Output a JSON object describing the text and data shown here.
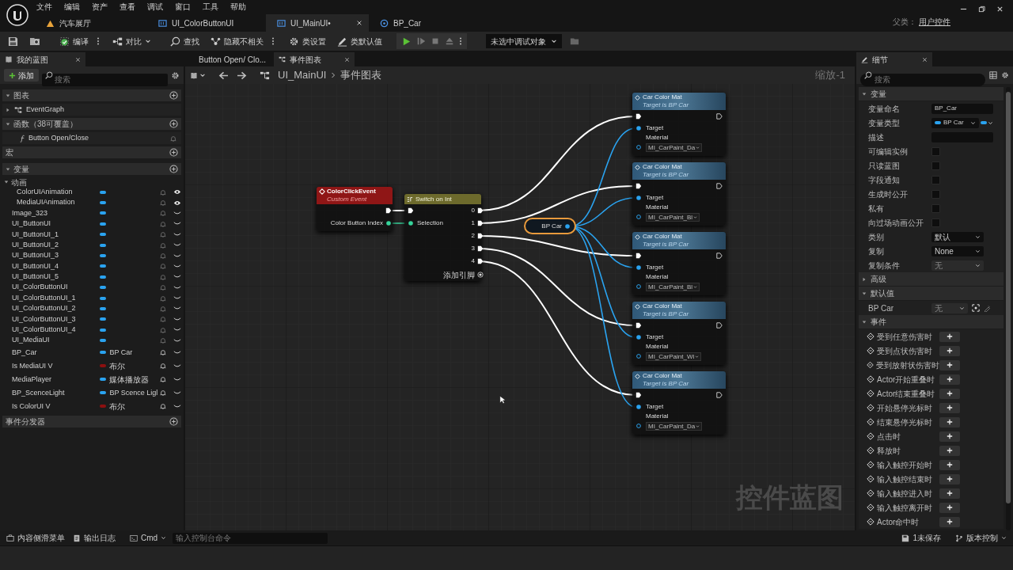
{
  "menu": [
    "文件",
    "编辑",
    "资产",
    "查看",
    "调试",
    "窗口",
    "工具",
    "帮助"
  ],
  "doc_tabs": [
    {
      "label": "汽车展厅",
      "selected": false
    },
    {
      "label": "UI_ColorButtonUI",
      "selected": false
    },
    {
      "label": "UI_MainUI•",
      "selected": true
    },
    {
      "label": "BP_Car",
      "selected": false
    }
  ],
  "parent_class": {
    "label": "父类：",
    "value": "用户控件"
  },
  "toolbar": {
    "compile": "编译",
    "diff": "对比",
    "find": "查找",
    "hide": "隐藏不相关",
    "class_settings": "类设置",
    "class_defaults": "类默认值",
    "debug_target": "未选中调试对象"
  },
  "my_blueprint": {
    "title": "我的蓝图",
    "add": "添加",
    "search_placeholder": "搜索",
    "items": [
      {
        "kind": "header",
        "label": "图表",
        "expanded": true
      },
      {
        "kind": "graph",
        "label": "EventGraph"
      },
      {
        "kind": "header",
        "label": "函数（38可覆盖）",
        "expanded": true
      },
      {
        "kind": "function",
        "label": "Button Open/Close"
      },
      {
        "kind": "plain_header",
        "label": "宏"
      },
      {
        "kind": "header",
        "label": "变量",
        "expanded": true
      },
      {
        "kind": "category",
        "label": "动画"
      },
      {
        "kind": "anim_var",
        "name": "ColorUIAnimation",
        "color": "#2aa3f0"
      },
      {
        "kind": "anim_var",
        "name": "MediaUIAnimation",
        "color": "#2aa3f0"
      },
      {
        "kind": "var",
        "name": "Image_323",
        "color": "#2aa3f0"
      },
      {
        "kind": "var",
        "name": "UI_ButtonUI",
        "color": "#2aa3f0"
      },
      {
        "kind": "var",
        "name": "UI_ButtonUI_1",
        "color": "#2aa3f0"
      },
      {
        "kind": "var",
        "name": "UI_ButtonUI_2",
        "color": "#2aa3f0"
      },
      {
        "kind": "var",
        "name": "UI_ButtonUI_3",
        "color": "#2aa3f0"
      },
      {
        "kind": "var",
        "name": "UI_ButtonUI_4",
        "color": "#2aa3f0"
      },
      {
        "kind": "var",
        "name": "UI_ButtonUI_5",
        "color": "#2aa3f0"
      },
      {
        "kind": "var",
        "name": "UI_ColorButtonUI",
        "color": "#2aa3f0"
      },
      {
        "kind": "var",
        "name": "UI_ColorButtonUI_1",
        "color": "#2aa3f0"
      },
      {
        "kind": "var",
        "name": "UI_ColorButtonUI_2",
        "color": "#2aa3f0"
      },
      {
        "kind": "var",
        "name": "UI_ColorButtonUI_3",
        "color": "#2aa3f0"
      },
      {
        "kind": "var",
        "name": "UI_ColorButtonUI_4",
        "color": "#2aa3f0"
      },
      {
        "kind": "var",
        "name": "UI_MediaUI",
        "color": "#2aa3f0"
      },
      {
        "kind": "typed_var",
        "name": "BP_Car",
        "color": "#2aa3f0",
        "type": "BP Car"
      },
      {
        "kind": "typed_var",
        "name": "Is MediaUI V",
        "color": "#8c1010",
        "type": "布尔"
      },
      {
        "kind": "typed_var",
        "name": "MediaPlayer",
        "color": "#2aa3f0",
        "type": "媒体播放器"
      },
      {
        "kind": "typed_var",
        "name": "BP_ScenceLight",
        "color": "#2aa3f0",
        "type": "BP Scence Ligl"
      },
      {
        "kind": "typed_var",
        "name": "Is ColorUI V",
        "color": "#8c1010",
        "type": "布尔"
      },
      {
        "kind": "plain_header",
        "label": "事件分发器"
      }
    ]
  },
  "graph": {
    "tabs": [
      {
        "label": "Button Open/ Clo...",
        "selected": false
      },
      {
        "label": "事件图表",
        "selected": true
      }
    ],
    "breadcrumb": [
      "UI_MainUI",
      "事件图表"
    ],
    "zoom": "缩放-1",
    "watermark": "控件蓝图",
    "event_node": {
      "title": "ColorClickEvent",
      "subtitle": "Custom Event",
      "pin": "Color Button Index"
    },
    "switch_node": {
      "title": "Switch on Int",
      "input": "Selection",
      "outputs": [
        "0",
        "1",
        "2",
        "3",
        "4"
      ],
      "add_pin": "添加引脚"
    },
    "variable_node": {
      "label": "BP Car",
      "selected": true
    },
    "call_nodes": [
      {
        "title": "Car Color Mat",
        "subtitle": "Target is BP Car",
        "target": "Target",
        "material_label": "Material",
        "material": "MI_CarPaint_Da"
      },
      {
        "title": "Car Color Mat",
        "subtitle": "Target is BP Car",
        "target": "Target",
        "material_label": "Material",
        "material": "MI_CarPaint_Bl"
      },
      {
        "title": "Car Color Mat",
        "subtitle": "Target is BP Car",
        "target": "Target",
        "material_label": "Material",
        "material": "MI_CarPaint_Bl"
      },
      {
        "title": "Car Color Mat",
        "subtitle": "Target is BP Car",
        "target": "Target",
        "material_label": "Material",
        "material": "MI_CarPaint_Wi"
      },
      {
        "title": "Car Color Mat",
        "subtitle": "Target is BP Car",
        "target": "Target",
        "material_label": "Material",
        "material": "MI_CarPaint_Da"
      }
    ]
  },
  "details": {
    "title": "细节",
    "search_placeholder": "搜索",
    "rows": [
      {
        "kind": "header",
        "label": "变量",
        "expanded": true
      },
      {
        "kind": "text",
        "label": "变量命名",
        "value": "BP_Car"
      },
      {
        "kind": "type",
        "label": "变量类型",
        "value": "BP Car"
      },
      {
        "kind": "text",
        "label": "描述"
      },
      {
        "kind": "check",
        "label": "可编辑实例",
        "checked": false
      },
      {
        "kind": "check",
        "label": "只读蓝图",
        "checked": false
      },
      {
        "kind": "check",
        "label": "字段通知",
        "checked": false
      },
      {
        "kind": "check",
        "label": "生成时公开",
        "checked": false
      },
      {
        "kind": "check",
        "label": "私有",
        "checked": false
      },
      {
        "kind": "check",
        "label": "向过场动画公开",
        "checked": false
      },
      {
        "kind": "select",
        "label": "类别",
        "value": "默认",
        "disabled": false
      },
      {
        "kind": "select",
        "label": "复制",
        "value": "None",
        "disabled": false
      },
      {
        "kind": "select",
        "label": "复制条件",
        "value": "无",
        "disabled": true
      },
      {
        "kind": "header",
        "label": "高级",
        "expanded": false
      },
      {
        "kind": "header",
        "label": "默认值",
        "expanded": true
      },
      {
        "kind": "object",
        "label": "BP Car",
        "value": "无"
      },
      {
        "kind": "header",
        "label": "事件",
        "expanded": true
      },
      {
        "kind": "event",
        "label": "受到任意伤害时"
      },
      {
        "kind": "event",
        "label": "受到点状伤害时"
      },
      {
        "kind": "event",
        "label": "受到放射状伤害时"
      },
      {
        "kind": "event",
        "label": "Actor开始重叠时"
      },
      {
        "kind": "event",
        "label": "Actor结束重叠时"
      },
      {
        "kind": "event",
        "label": "开始悬停光标时"
      },
      {
        "kind": "event",
        "label": "结束悬停光标时"
      },
      {
        "kind": "event",
        "label": "点击时"
      },
      {
        "kind": "event",
        "label": "释放时"
      },
      {
        "kind": "event",
        "label": "输入触控开始时"
      },
      {
        "kind": "event",
        "label": "输入触控结束时"
      },
      {
        "kind": "event",
        "label": "输入触控进入时"
      },
      {
        "kind": "event",
        "label": "输入触控离开时"
      },
      {
        "kind": "event",
        "label": "Actor命中时"
      }
    ]
  },
  "status_bar": {
    "content_drawer": "内容侧滑菜单",
    "output_log": "输出日志",
    "cmd": "Cmd",
    "console_placeholder": "输入控制台命令",
    "unsaved": "1未保存",
    "source_control": "版本控制"
  }
}
